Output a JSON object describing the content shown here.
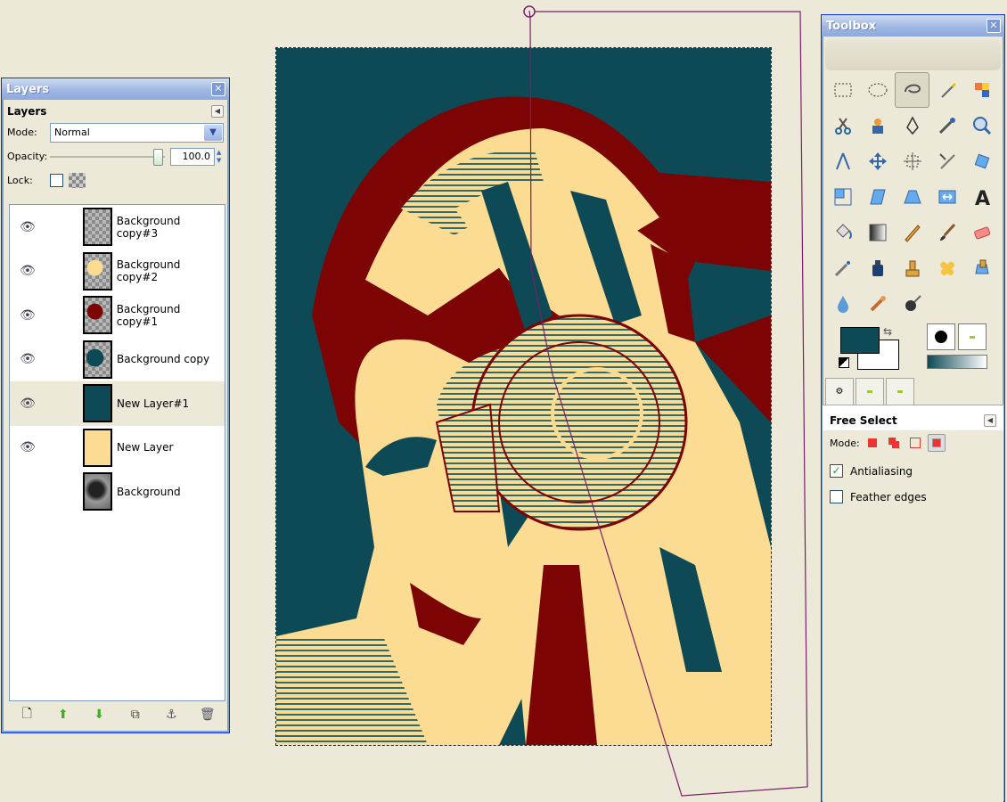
{
  "layers_window": {
    "title": "Layers",
    "panel_title": "Layers",
    "mode_label": "Mode:",
    "mode_value": "Normal",
    "opacity_label": "Opacity:",
    "opacity_value": "100.0",
    "lock_label": "Lock:",
    "layers": [
      {
        "name": "Background copy#3",
        "visible": true,
        "selected": false
      },
      {
        "name": "Background copy#2",
        "visible": true,
        "selected": false
      },
      {
        "name": "Background copy#1",
        "visible": true,
        "selected": false
      },
      {
        "name": "Background copy",
        "visible": true,
        "selected": false
      },
      {
        "name": "New Layer#1",
        "visible": true,
        "selected": true
      },
      {
        "name": "New Layer",
        "visible": true,
        "selected": false
      },
      {
        "name": "Background",
        "visible": false,
        "selected": false
      }
    ],
    "buttons": [
      "new-layer-icon",
      "raise-layer-icon",
      "lower-layer-icon",
      "duplicate-layer-icon",
      "anchor-layer-icon",
      "delete-layer-icon"
    ]
  },
  "toolbox": {
    "title": "Toolbox",
    "tools": [
      "rect-select-icon",
      "ellipse-select-icon",
      "free-select-icon",
      "fuzzy-select-icon",
      "select-by-color-icon",
      "scissors-icon",
      "foreground-select-icon",
      "paths-icon",
      "color-picker-icon",
      "zoom-icon",
      "measure-icon",
      "move-icon",
      "align-icon",
      "crop-icon",
      "rotate-icon",
      "scale-icon",
      "shear-icon",
      "perspective-icon",
      "flip-icon",
      "text-icon",
      "bucket-fill-icon",
      "blend-icon",
      "pencil-icon",
      "paintbrush-icon",
      "eraser-icon",
      "airbrush-icon",
      "ink-icon",
      "clone-icon",
      "heal-icon",
      "perspective-clone-icon",
      "blur-icon",
      "smudge-icon",
      "dodge-burn-icon"
    ],
    "active_tool": "free-select-icon",
    "fg_color": "#0d4a55",
    "bg_color": "#ffffff"
  },
  "tool_options": {
    "title": "Free Select",
    "mode_label": "Mode:",
    "antialiasing_label": "Antialiasing",
    "antialiasing_checked": true,
    "feather_label": "Feather edges",
    "feather_checked": false
  },
  "palette": {
    "teal": "#0d4a55",
    "cream": "#fcdc92",
    "red": "#7c0404"
  }
}
